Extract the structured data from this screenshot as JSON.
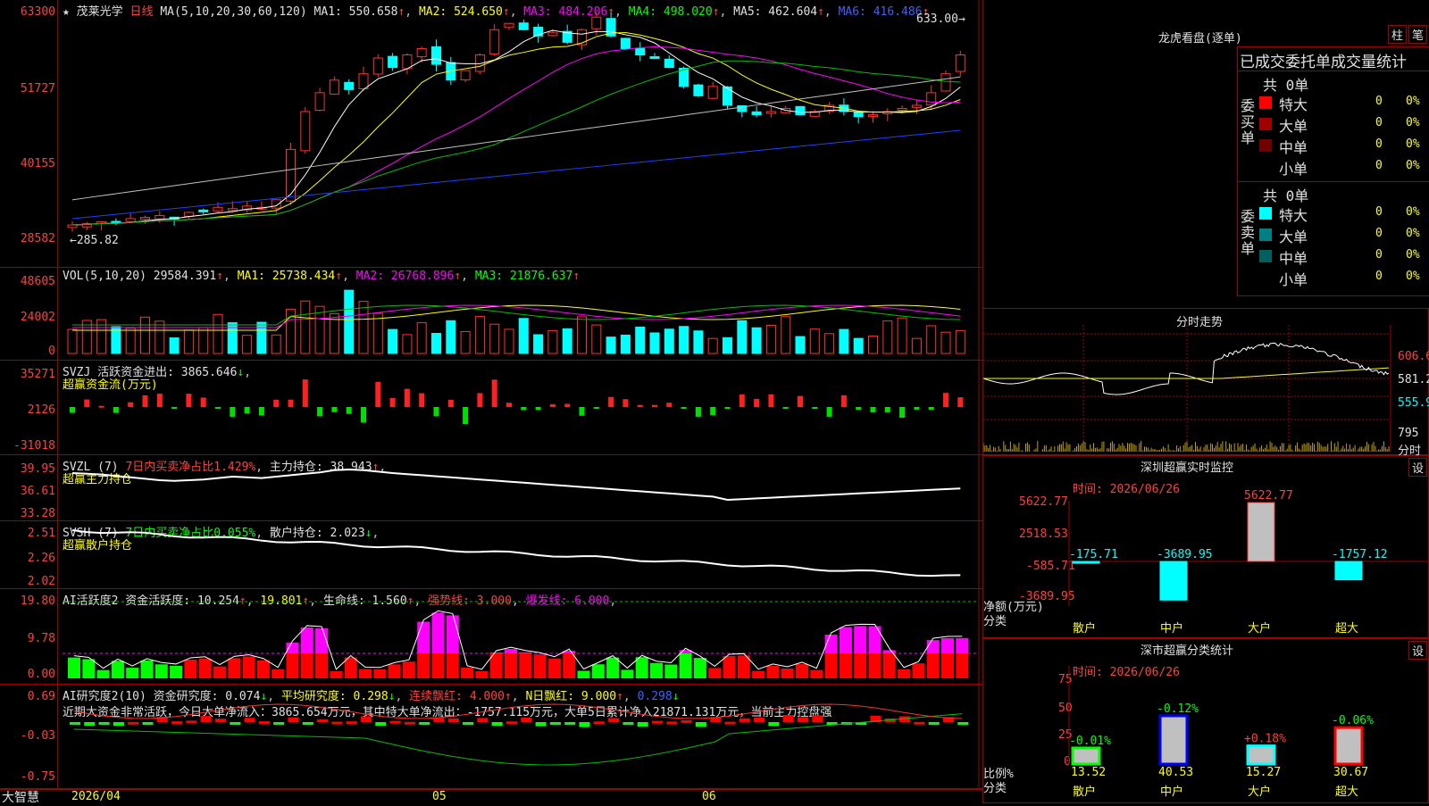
{
  "stock": {
    "name": "茂莱光学",
    "period": "日线",
    "star": "★"
  },
  "ma": {
    "label": "MA(5,10,20,30,60,120)",
    "ma1": "MA1: 550.658",
    "ma2": "MA2: 524.650",
    "ma3": "MA3: 484.206",
    "ma4": "MA4: 498.020",
    "ma5": "MA5: 462.604",
    "ma6": "MA6: 416.486"
  },
  "price_axis": [
    "63300",
    "51727",
    "40155",
    "28582"
  ],
  "price_marks": {
    "high": "633.00",
    "low": "285.82"
  },
  "vol": {
    "label": "VOL(5,10,20)",
    "value": "29584.391",
    "ma1": "MA1: 25738.434",
    "ma2": "MA2: 26768.896",
    "ma3": "MA3: 21876.637",
    "axis": [
      "48605",
      "24002",
      "0"
    ]
  },
  "svzj": {
    "label": "SVZJ  活跃资金进出: 3865.646",
    "sub": "超赢资金流(万元)",
    "axis": [
      "35271",
      "2126",
      "-31018"
    ]
  },
  "svzl": {
    "label": "SVZL (7)",
    "pct": "7日内买卖净占比1.429%",
    "hold": "主力持仓: 38.943",
    "sub": "超赢主力持仓",
    "axis": [
      "39.95",
      "36.61",
      "33.28"
    ]
  },
  "svsh": {
    "label": "SVSH (7)",
    "pct": "7日内买卖净占比0.055%",
    "hold": "散户持仓: 2.023",
    "sub": "超赢散户持仓",
    "axis": [
      "2.51",
      "2.26",
      "2.02"
    ]
  },
  "ai2": {
    "label": "AI活跃度2 资金活跃度: 10.254",
    "v2": "19.801",
    "life": "生命线: 1.560",
    "strong": "强势线: 3.000",
    "burst": "爆发线: 6.000",
    "axis": [
      "19.80",
      "9.78",
      "0.00"
    ]
  },
  "ai3": {
    "label": "AI研究度2(10) 资金研究度: 0.074",
    "avg": "平均研究度: 0.298",
    "cont": "连续飘红: 4.000",
    "nday": "N日飘红: 9.000",
    "last": "0.298",
    "text": "近期大资金非常活跃，今日大单净流入：3865.654万元，其中特大单净流出：-1757.115万元，大单5日累计净入21871.131万元，当前主力控盘强",
    "axis": [
      "0.69",
      "-0.03",
      "-0.75"
    ]
  },
  "dates": {
    "d1": "2026/04",
    "d2": "05",
    "d3": "06"
  },
  "brand": "大智慧",
  "lhb": {
    "title": "龙虎看盘(逐单)",
    "btn1": "柱",
    "btn2": "笔",
    "tabs": "已成交委托单成交量统计",
    "buy": {
      "title": "委买单",
      "total": "共 0单",
      "rows": [
        {
          "n": "特大",
          "v": "0",
          "p": "0%",
          "c": "#ff0000"
        },
        {
          "n": "大单",
          "v": "0",
          "p": "0%",
          "c": "#a00000"
        },
        {
          "n": "中单",
          "v": "0",
          "p": "0%",
          "c": "#700000"
        },
        {
          "n": "小单",
          "v": "0",
          "p": "0%",
          "c": "#000"
        }
      ]
    },
    "sell": {
      "title": "委卖单",
      "total": "共 0单",
      "rows": [
        {
          "n": "特大",
          "v": "0",
          "p": "0%",
          "c": "#00ffff"
        },
        {
          "n": "大单",
          "v": "0",
          "p": "0%",
          "c": "#008080"
        },
        {
          "n": "中单",
          "v": "0",
          "p": "0%",
          "c": "#006060"
        },
        {
          "n": "小单",
          "v": "0",
          "p": "0%",
          "c": "#000"
        }
      ]
    }
  },
  "intraday": {
    "title": "分时走势",
    "p1": "606.6",
    "p2": "581.2",
    "p3": "555.9",
    "v": "795",
    "unit": "分时"
  },
  "monitor": {
    "title": "深圳超赢实时监控",
    "set": "设",
    "time": "时间: 2026/06/26",
    "axis": [
      "5622.77",
      "2518.53",
      "-585.71",
      "-3689.95"
    ],
    "ylabel": "净额(万元)",
    "xlabel": "分类",
    "cats": [
      "散户",
      "中户",
      "大户",
      "超大"
    ],
    "vals": [
      "-175.71",
      "-3689.95",
      "5622.77",
      "-1757.12"
    ]
  },
  "classify": {
    "title": "深市超赢分类统计",
    "set": "设",
    "time": "时间: 2026/06/26",
    "axis": [
      "75",
      "50",
      "25",
      "0"
    ],
    "ylabel": "比例%",
    "xlabel": "分类",
    "cats": [
      "散户",
      "中户",
      "大户",
      "超大"
    ],
    "pct": [
      "-0.01%",
      "-0.12%",
      "+0.18%",
      "-0.06%"
    ],
    "vals": [
      "13.52",
      "40.53",
      "15.27",
      "30.67"
    ]
  },
  "chart_data": {
    "type": "candlestick",
    "title": "茂莱光学 日线",
    "ylim": [
      285.82,
      633.0
    ],
    "last_close": 633.0
  }
}
